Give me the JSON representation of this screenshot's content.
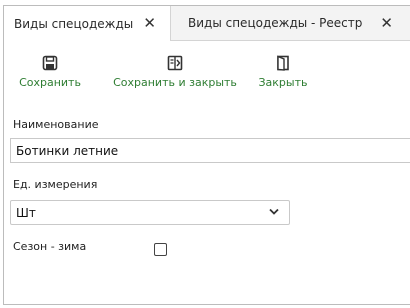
{
  "tabs": [
    {
      "label": "Виды спецодежды",
      "close": "✕"
    },
    {
      "label": "Виды спецодежды - Реестр",
      "close": "✕"
    }
  ],
  "toolbar": {
    "save_label": "Сохранить",
    "save_close_label": "Сохранить и закрыть",
    "close_label": "Закрыть",
    "accent_color": "#2e7d32"
  },
  "form": {
    "name_label": "Наименование",
    "name_value": "Ботинки летние",
    "unit_label": "Ед. измерения",
    "unit_value": "Шт",
    "season_label": "Сезон - зима"
  }
}
